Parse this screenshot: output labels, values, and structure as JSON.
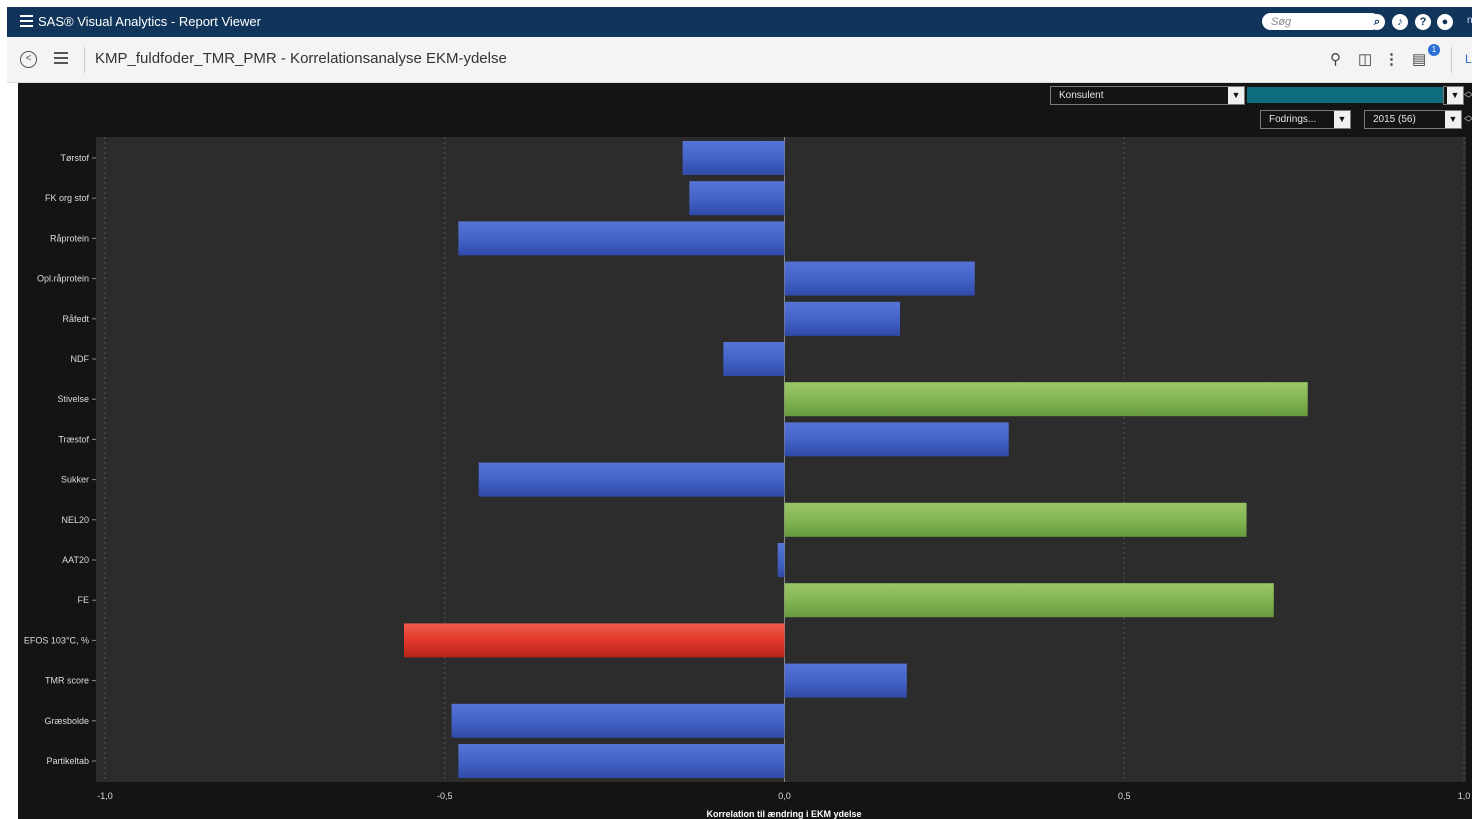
{
  "app": {
    "title": "SAS® Visual Analytics - Report Viewer",
    "search_placeholder": "Søg",
    "user_label": "nb",
    "icons": [
      "search-icon",
      "bell-icon",
      "help-icon",
      "user-icon"
    ]
  },
  "report": {
    "title": "KMP_fuldfoder_TMR_PMR - Korrelationsanalyse EKM-ydelse",
    "notification_count": "1",
    "close_label": "Lu"
  },
  "filters": {
    "konsulent_label": "Konsulent",
    "fodring_label": "Fodrings...",
    "year_label": "2015 (56)",
    "teal_color": "#0d6f7d"
  },
  "colors": {
    "positive_bar": "#7fb14e",
    "negative_bar": "#e0372a",
    "neutral_bar": "#3f5fc4",
    "plot_bg": "#2c2c2c",
    "topbar": "#11355a"
  },
  "chart_data": {
    "type": "bar",
    "orientation": "horizontal",
    "xlabel": "Korrelation til ændring i EKM ydelse",
    "xlim": [
      -1.0,
      1.0
    ],
    "xticks": [
      -1.0,
      -0.5,
      0.0,
      0.5,
      1.0
    ],
    "xtick_labels": [
      "-1,0",
      "-0,5",
      "0,0",
      "0,5",
      "1,0"
    ],
    "grid": true,
    "categories": [
      "Tørstof",
      "FK org stof",
      "Råprotein",
      "Opl.råprotein",
      "Råfedt",
      "NDF",
      "Stivelse",
      "Træstof",
      "Sukker",
      "NEL20",
      "AAT20",
      "FE",
      "EFOS 103°C, %",
      "TMR score",
      "Græsbolde",
      "Partikeltab"
    ],
    "values": [
      -0.15,
      -0.14,
      -0.48,
      0.28,
      0.17,
      -0.09,
      0.77,
      0.33,
      -0.45,
      0.68,
      -0.01,
      0.72,
      -0.56,
      0.18,
      -0.49,
      -0.48
    ],
    "bar_color_class": [
      "neutral",
      "neutral",
      "neutral",
      "neutral",
      "neutral",
      "neutral",
      "positive",
      "neutral",
      "neutral",
      "positive",
      "neutral",
      "positive",
      "negative",
      "neutral",
      "neutral",
      "neutral"
    ]
  }
}
